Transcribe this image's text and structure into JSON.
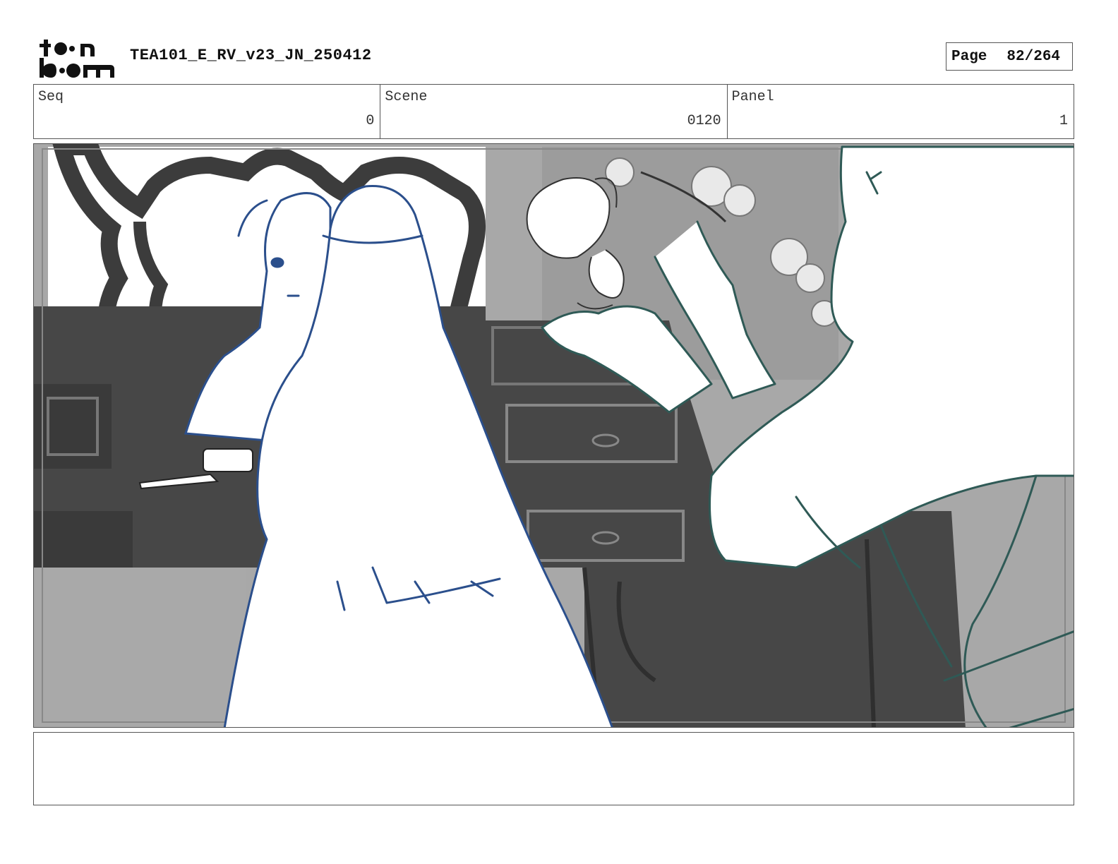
{
  "header": {
    "logo_text": "toon boom",
    "title": "TEA101_E_RV_v23_JN_250412",
    "page_label": "Page",
    "page_value": "82/264"
  },
  "info": {
    "seq_label": "Seq",
    "seq_value": "0",
    "scene_label": "Scene",
    "scene_value": "0120",
    "panel_label": "Panel",
    "panel_value": "1"
  },
  "notes": {
    "text": ""
  },
  "colors": {
    "blue_line": "#2b4f8c",
    "green_line": "#2f5a56",
    "furniture_dark": "#444444",
    "wall_gray": "#a9a9a9"
  }
}
